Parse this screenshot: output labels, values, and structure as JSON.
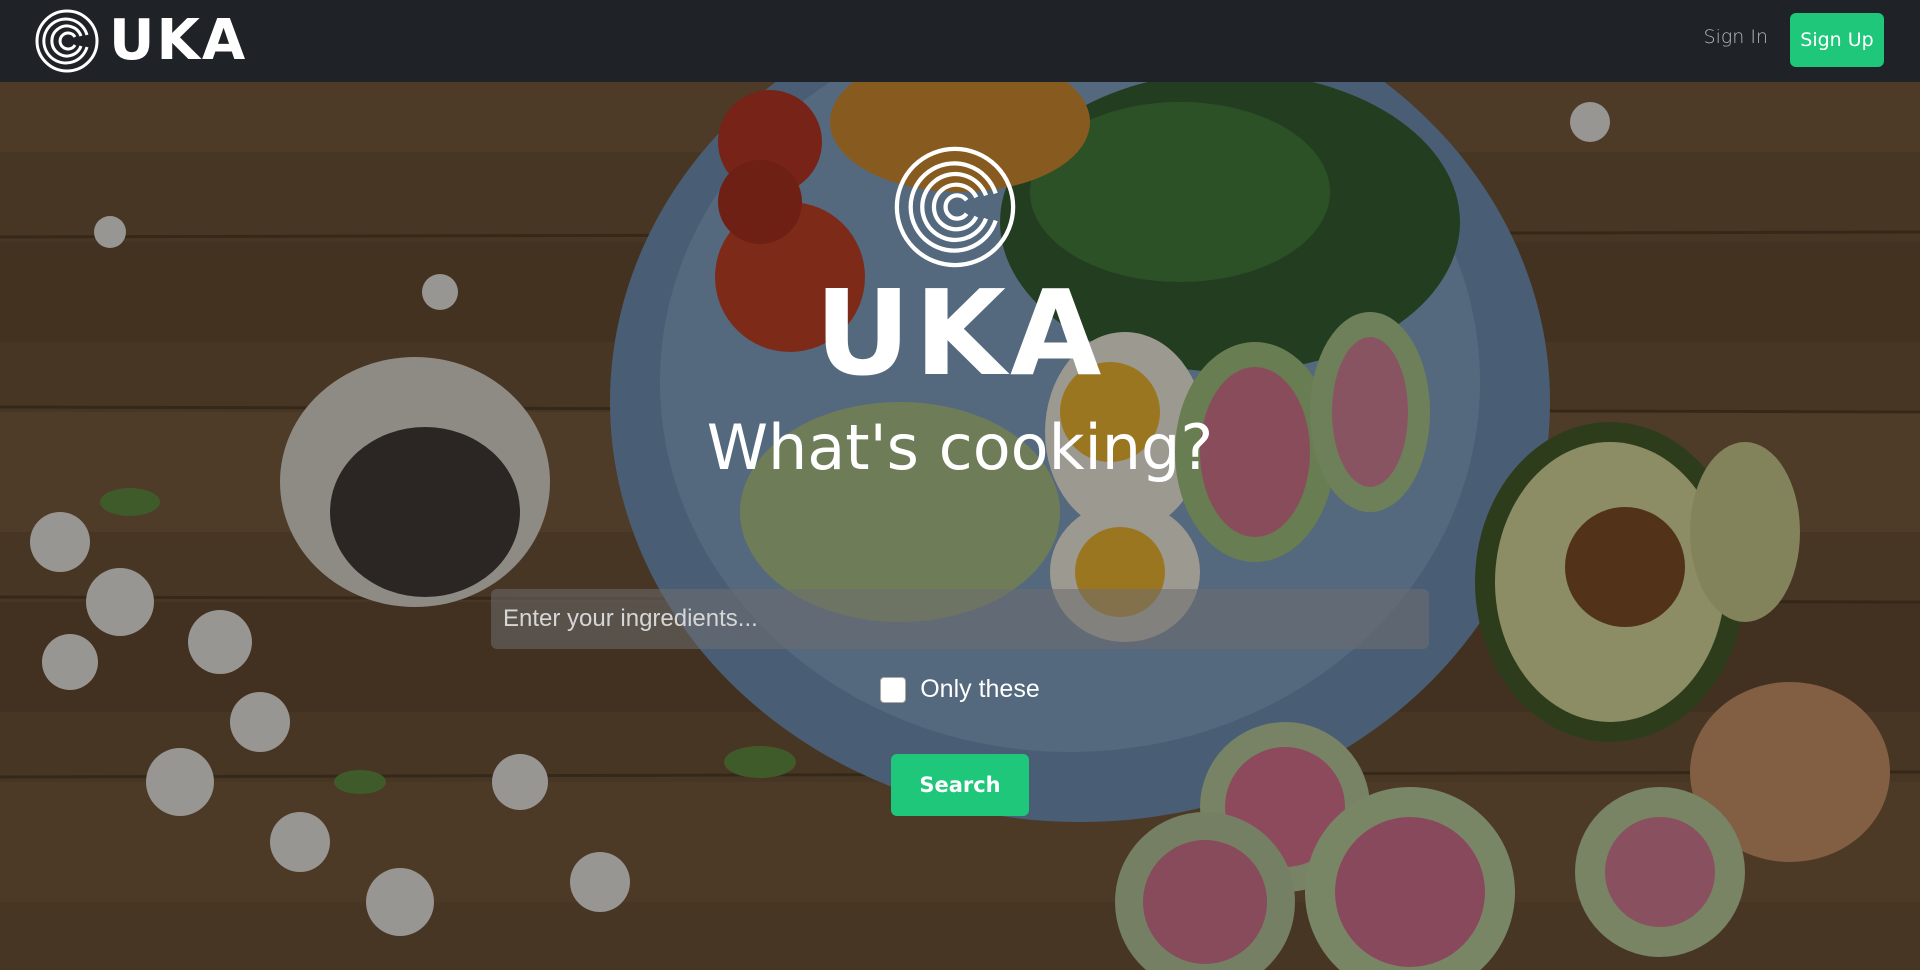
{
  "navbar": {
    "brand_name": "UKA",
    "sign_in_label": "Sign In",
    "sign_up_label": "Sign Up"
  },
  "hero": {
    "brand_name": "UKA",
    "title": "What's cooking?",
    "search": {
      "placeholder": "Enter your ingredients...",
      "value": ""
    },
    "only_these": {
      "label": "Only these",
      "checked": false
    },
    "search_button_label": "Search"
  },
  "icons": {
    "brand_logo": "concentric-c-logo-icon",
    "hero_logo": "concentric-c-logo-icon"
  },
  "colors": {
    "navbar_bg": "#1f2327",
    "accent_green": "#1ec77a",
    "text_white": "#ffffff",
    "nav_link_gray": "#b5b8bb"
  }
}
